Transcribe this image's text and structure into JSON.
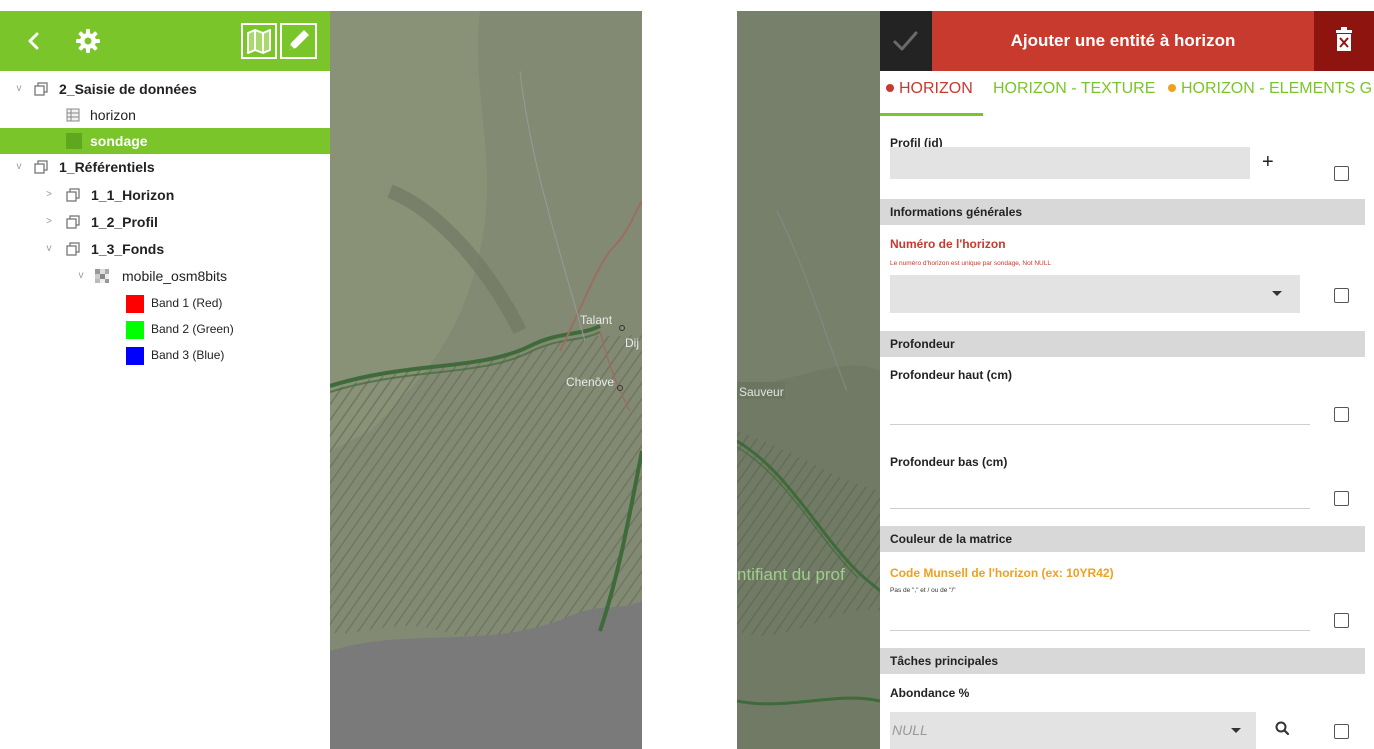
{
  "left": {
    "toolbar": {
      "back_icon": "chevron-left-icon",
      "settings_icon": "gear-icon",
      "map_icon": "map-icon",
      "edit_icon": "pencil-icon",
      "accent": "#7ac52a"
    },
    "tree": [
      {
        "label": "2_Saisie de données",
        "bold": true
      },
      {
        "label": "horizon",
        "bold": false
      },
      {
        "label": "sondage",
        "bold": true,
        "selected": true
      },
      {
        "label": "1_Référentiels",
        "bold": true
      },
      {
        "label": "1_1_Horizon",
        "bold": true
      },
      {
        "label": "1_2_Profil",
        "bold": true
      },
      {
        "label": "1_3_Fonds",
        "bold": true
      },
      {
        "label": "mobile_osm8bits",
        "bold": false
      }
    ],
    "bands": [
      {
        "label": "Band 1 (Red)",
        "color": "#ff0000"
      },
      {
        "label": "Band 2 (Green)",
        "color": "#00ff00"
      },
      {
        "label": "Band 3 (Blue)",
        "color": "#0000ff"
      }
    ],
    "map_labels": {
      "talant": "Talant",
      "dijon": "Dij",
      "chenove": "Chenôve"
    }
  },
  "right": {
    "map_labels": {
      "sauveur": "Sauveur",
      "ntifiant": "ntifiant du prof"
    },
    "header": {
      "title": "Ajouter une entité à horizon",
      "bg": "#c8392e",
      "accept_icon": "check-icon",
      "delete_icon": "trash-icon"
    },
    "tabs": [
      {
        "label": "HORIZON",
        "dot": "#c8392e",
        "color": "#c8392e"
      },
      {
        "label": "HORIZON - TEXTURE",
        "dot": "",
        "color": "#7ac52a"
      },
      {
        "label": "HORIZON - ELEMENTS G",
        "dot": "#f0a01e",
        "color": "#7ac52a"
      }
    ],
    "fields": {
      "profil_label": "Profil (id)",
      "plus": "+",
      "section_infos": "Informations générales",
      "numero_label": "Numéro de l'horizon",
      "numero_hint": "Le numéro d'horizon est unique par sondage, Not NULL",
      "section_profondeur": "Profondeur",
      "haut_label": "Profondeur haut (cm)",
      "bas_label": "Profondeur bas (cm)",
      "section_couleur": "Couleur de la matrice",
      "munsell_label": "Code Munsell de l'horizon (ex: 10YR42)",
      "munsell_hint": "Pas de \",\" et / ou de \"/\"",
      "section_taches": "Tâches principales",
      "abondance_label": "Abondance %",
      "abondance_value": "NULL"
    }
  }
}
